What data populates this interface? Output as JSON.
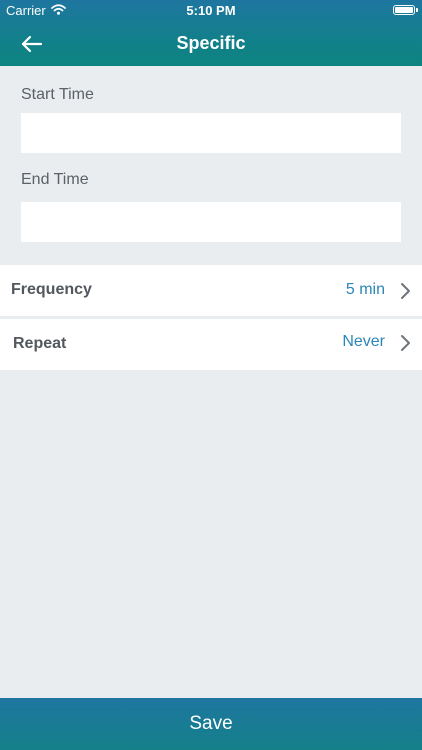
{
  "status_bar": {
    "carrier": "Carrier",
    "time": "5:10 PM",
    "wifi_icon": "wifi-icon",
    "battery_icon": "battery-icon"
  },
  "nav": {
    "title": "Specific",
    "back_icon": "back-arrow-icon"
  },
  "form": {
    "start_time": {
      "label": "Start Time",
      "value": "",
      "placeholder": ""
    },
    "end_time": {
      "label": "End Time",
      "value": "",
      "placeholder": ""
    }
  },
  "settings": {
    "frequency": {
      "label": "Frequency",
      "value": "5 min",
      "icon": "chevron-right-icon"
    },
    "repeat": {
      "label": "Repeat",
      "value": "Never",
      "icon": "chevron-right-icon"
    }
  },
  "footer": {
    "save_label": "Save"
  },
  "colors": {
    "header_gradient_top": "#1e76a0",
    "header_gradient_bottom": "#0e8480",
    "background": "#eaedf0",
    "accent_value": "#2b86b8",
    "label_text": "#52585d"
  }
}
